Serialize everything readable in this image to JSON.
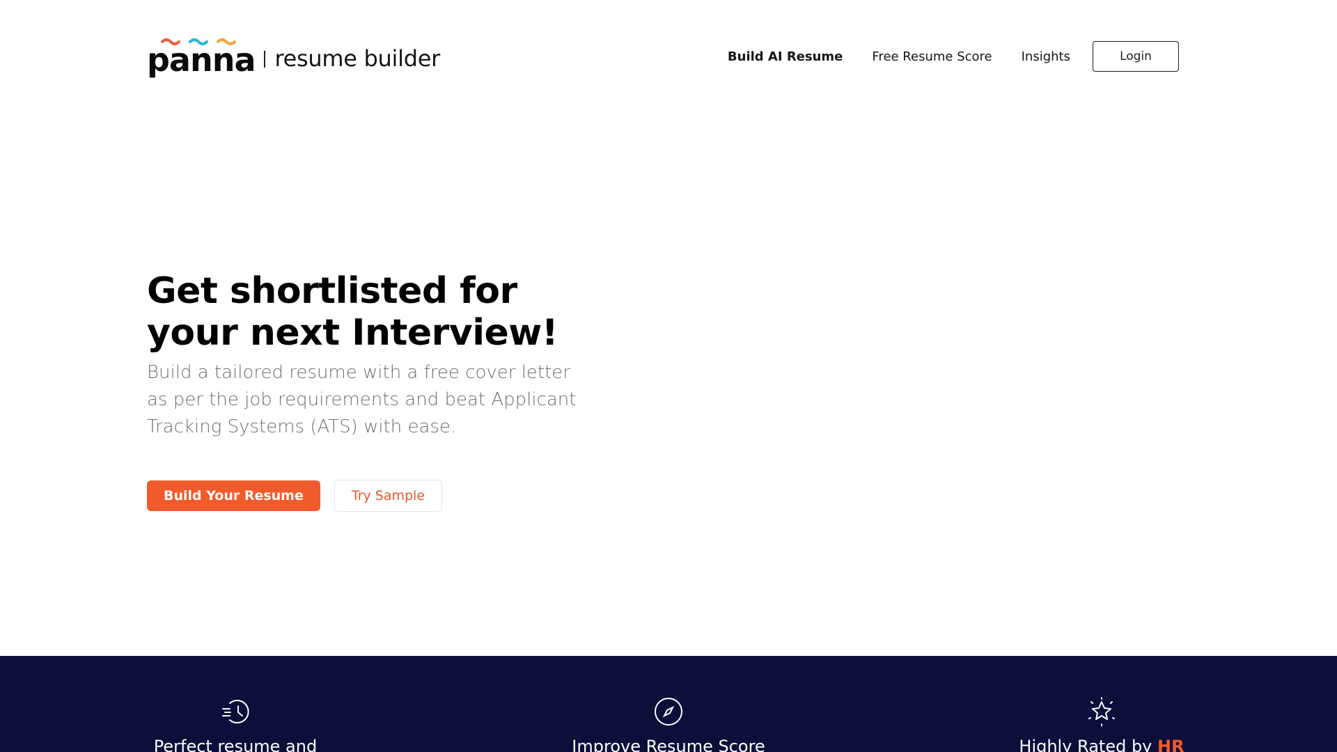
{
  "brand": {
    "logo_word": "panna",
    "tagline": "resume builder",
    "colors": {
      "wave_red": "#f05a3c",
      "wave_teal": "#25b5d3",
      "wave_orange": "#f7a23b"
    }
  },
  "nav": {
    "items": [
      {
        "label": "Build AI Resume",
        "active": true
      },
      {
        "label": "Free Resume Score",
        "active": false
      },
      {
        "label": "Insights",
        "active": false
      }
    ],
    "login_label": "Login"
  },
  "hero": {
    "title_line1": "Get shortlisted for",
    "title_line2": "your next Interview!",
    "subtitle": "Build a tailored resume with a free cover letter as per the job requirements and beat Applicant Tracking Systems (ATS) with ease.",
    "primary_cta": "Build Your Resume",
    "secondary_cta": "Try Sample"
  },
  "features": [
    {
      "icon": "fast-clock-icon",
      "text": "Perfect resume and"
    },
    {
      "icon": "compass-icon",
      "text": "Improve Resume Score"
    },
    {
      "icon": "sparkle-star-icon",
      "text_prefix": "Highly Rated by",
      "text_accent": "HR"
    }
  ],
  "colors": {
    "accent": "#f15a2b",
    "band_background": "#0c0f3a",
    "subtitle_text": "#6f6f6f"
  }
}
